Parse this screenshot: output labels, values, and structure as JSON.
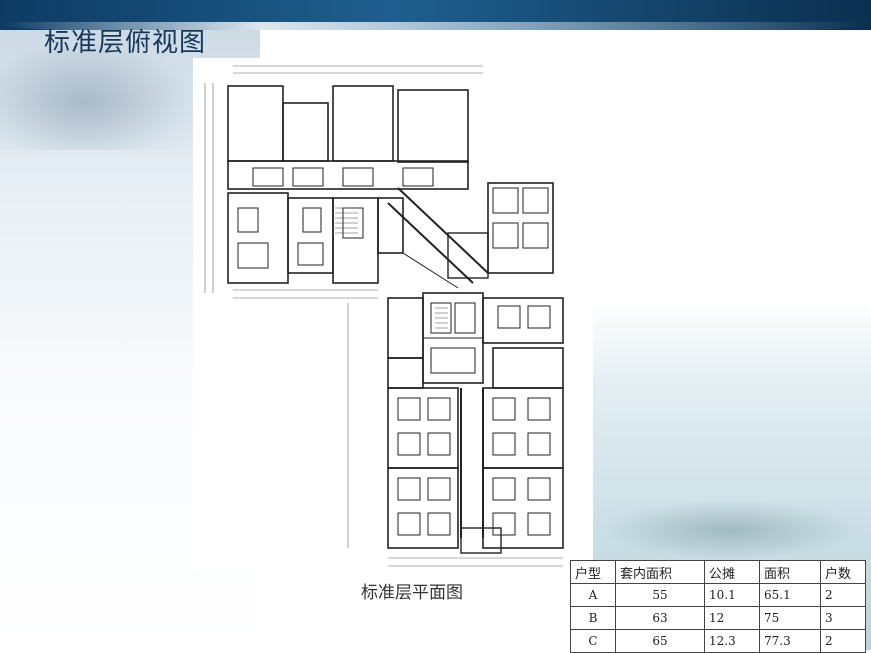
{
  "slide": {
    "title": "标准层俯视图",
    "caption": "标准层平面图"
  },
  "units_table": {
    "headers": [
      "户型",
      "套内面积",
      "公摊",
      "面积",
      "户数"
    ],
    "rows": [
      [
        "A",
        "55",
        "10.1",
        "65.1",
        "2"
      ],
      [
        "B",
        "63",
        "12",
        "75",
        "3"
      ],
      [
        "C",
        "65",
        "12.3",
        "77.3",
        "2"
      ]
    ]
  },
  "colors": {
    "title": "#17385a",
    "header_bar": "#0d3b63"
  }
}
